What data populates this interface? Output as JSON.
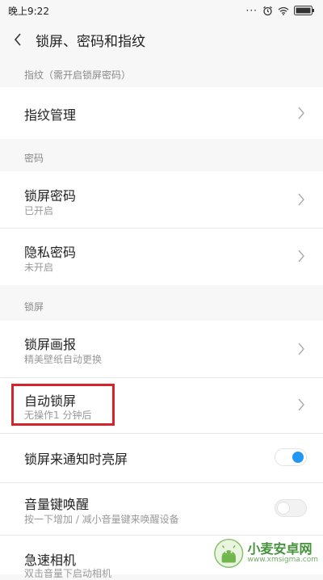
{
  "status_bar": {
    "time": "晚上9:22",
    "dots": "···"
  },
  "header": {
    "title": "锁屏、密码和指纹"
  },
  "sections": {
    "fingerprint_header": "指纹（需开启锁屏密码）",
    "password_header": "密码",
    "lockscreen_header": "锁屏"
  },
  "rows": {
    "fingerprint_manage": {
      "title": "指纹管理"
    },
    "lock_password": {
      "title": "锁屏密码",
      "subtitle": "已开启"
    },
    "privacy_password": {
      "title": "隐私密码",
      "subtitle": "未开启"
    },
    "lock_wallpaper": {
      "title": "锁屏画报",
      "subtitle": "精美壁纸自动更换"
    },
    "auto_lock": {
      "title": "自动锁屏",
      "subtitle": "无操作1 分钟后"
    },
    "notify_wake": {
      "title": "锁屏来通知时亮屏",
      "toggle": "on"
    },
    "volume_wake": {
      "title": "音量键唤醒",
      "subtitle": "按一下增加 / 减小音量键来唤醒设备",
      "toggle": "off"
    },
    "quick_camera": {
      "title": "急速相机",
      "subtitle": "双击音量下启动相机"
    }
  },
  "watermark": {
    "title": "小麦安卓网",
    "url": "www.xmsigma.com"
  },
  "colors": {
    "toggle_on": "#2196f3",
    "highlight": "#d6222b",
    "watermark": "#3a8d2f"
  }
}
